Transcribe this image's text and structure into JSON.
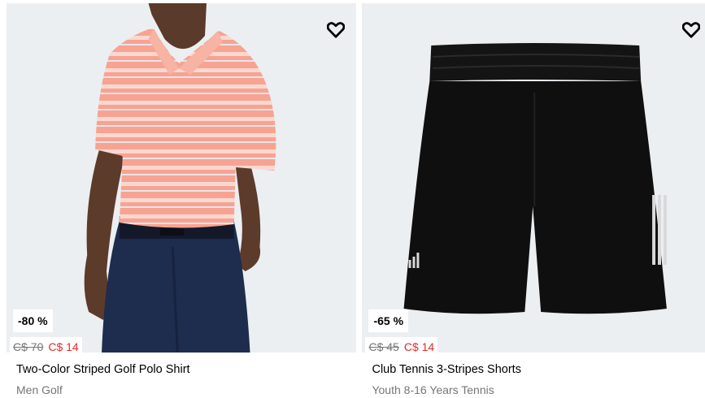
{
  "products": [
    {
      "discount": "-80 %",
      "old_price": "C$ 70",
      "new_price": "C$ 14",
      "name": "Two-Color Striped Golf Polo Shirt",
      "category": "Men Golf",
      "image_icon": "golf-polo-shirt-photo",
      "wishlist_icon": "heart-icon"
    },
    {
      "discount": "-65 %",
      "old_price": "C$ 45",
      "new_price": "C$ 14",
      "name": "Club Tennis 3-Stripes Shorts",
      "category": "Youth 8-16 Years Tennis",
      "image_icon": "tennis-shorts-photo",
      "wishlist_icon": "heart-icon"
    }
  ],
  "colors": {
    "image_background": "#eceff1",
    "sale_price": "#e32b2b",
    "strikethrough_price": "#767677",
    "subtitle": "#767677"
  }
}
